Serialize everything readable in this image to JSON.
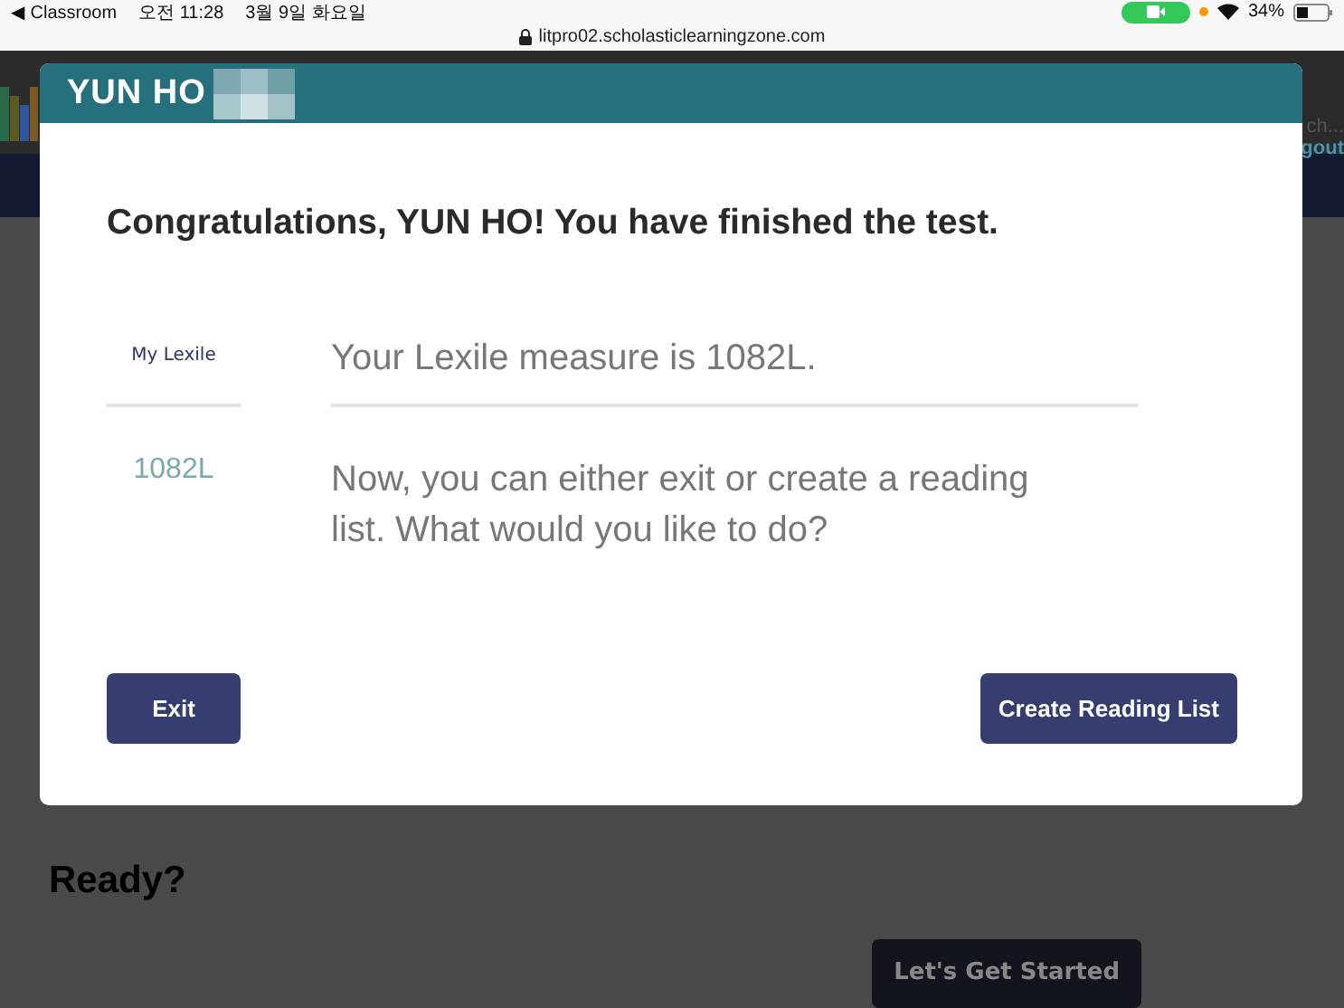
{
  "status_bar": {
    "back_app": "◀ Classroom",
    "time": "오전 11:28",
    "date": "3월 9일 화요일",
    "battery": "34%"
  },
  "address_bar": {
    "url": "litpro02.scholasticlearningzone.com"
  },
  "background_page": {
    "search_hint": "ch...",
    "logout": "gout",
    "heading": "Ready?",
    "start_button": "Let's Get Started"
  },
  "dialog": {
    "title": "YUN HO",
    "heading": "Congratulations, YUN HO! You have finished the test.",
    "side_label": "My Lexile",
    "side_value": "1082L",
    "measure": "Your Lexile measure is 1082L.",
    "prompt": "Now, you can either exit or create a reading list. What would you like to do?",
    "buttons": [
      {
        "label": "Exit"
      },
      {
        "label": "Create Reading List"
      }
    ]
  }
}
